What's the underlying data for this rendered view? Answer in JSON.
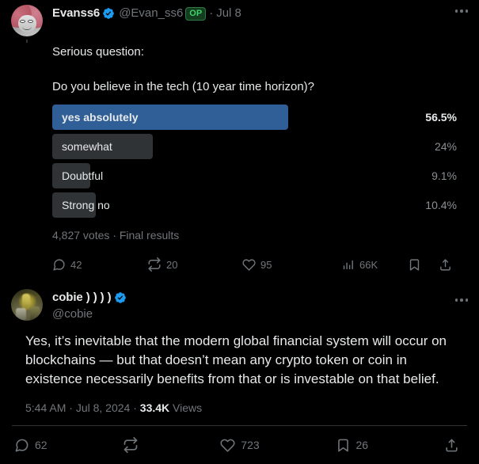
{
  "tweet1": {
    "display_name": "Evanss6",
    "verified": true,
    "handle": "@Evan_ss6",
    "op_badge": "OP",
    "separator": "·",
    "timestamp": "Jul 8",
    "more_label": "more-options",
    "text": "Serious question:",
    "poll": {
      "question": "Do you believe in the tech (10 year time horizon)?",
      "options": [
        {
          "label": "yes absolutely",
          "percent": "56.5%",
          "value": 56.5,
          "winner": true
        },
        {
          "label": "somewhat",
          "percent": "24%",
          "value": 24,
          "winner": false
        },
        {
          "label": "Doubtful",
          "percent": "9.1%",
          "value": 9.1,
          "winner": false
        },
        {
          "label": "Strong no",
          "percent": "10.4%",
          "value": 10.4,
          "winner": false
        }
      ],
      "meta": "4,827 votes · Final results"
    },
    "actions": {
      "reply": "42",
      "retweet": "20",
      "like": "95",
      "views": "66K",
      "bookmark": "",
      "share": ""
    }
  },
  "tweet2": {
    "display_name": "cobie ) ) ) )",
    "verified": true,
    "handle": "@cobie",
    "more_label": "more-options",
    "text": "Yes, it’s inevitable that the modern global financial system will occur on blockchains — but that doesn’t mean any crypto token or coin in existence necessarily benefits from that or is investable on that belief.",
    "meta": {
      "time": "5:44 AM",
      "sep1": "·",
      "date": "Jul 8, 2024",
      "sep2": "·",
      "views_count": "33.4K",
      "views_label": "Views"
    },
    "actions": {
      "reply": "62",
      "retweet": "",
      "like": "723",
      "bookmark": "26",
      "share": ""
    }
  },
  "colors": {
    "background": "#000000",
    "text": "#e7e9ea",
    "muted": "#71767b",
    "poll_winner_bar": "#2f5f96",
    "poll_bar": "#2f3336",
    "verified_blue": "#1d9bf0",
    "op_green": "#43d16a",
    "divider": "#2f3336"
  }
}
